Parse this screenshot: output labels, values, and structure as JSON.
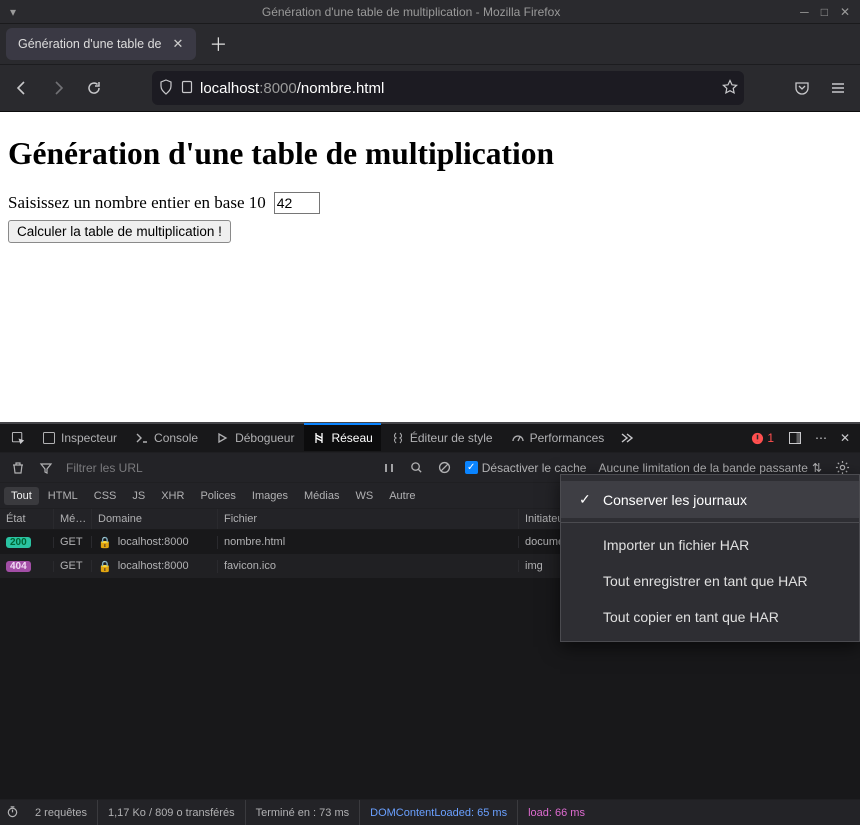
{
  "window": {
    "title": "Génération d'une table de multiplication - Mozilla Firefox"
  },
  "tab": {
    "title": "Génération d'une table de"
  },
  "url": {
    "host": "localhost",
    "port": ":8000",
    "path": "/nombre.html"
  },
  "page": {
    "heading": "Génération d'une table de multiplication",
    "label": "Saisissez un nombre entier en base 10",
    "input_value": "42",
    "button": "Calculer la table de multiplication !"
  },
  "devtools_tabs": {
    "inspector": "Inspecteur",
    "console": "Console",
    "debugger": "Débogueur",
    "network": "Réseau",
    "style": "Éditeur de style",
    "perf": "Performances",
    "error_count": "1"
  },
  "subbar": {
    "filter_placeholder": "Filtrer les URL",
    "disable_cache": "Désactiver le cache",
    "throttle": "Aucune limitation de la bande passante"
  },
  "filters": {
    "all": "Tout",
    "html": "HTML",
    "css": "CSS",
    "js": "JS",
    "xhr": "XHR",
    "fonts": "Polices",
    "images": "Images",
    "media": "Médias",
    "ws": "WS",
    "other": "Autre"
  },
  "net_headers": {
    "status": "État",
    "method": "Mé…",
    "domain": "Domaine",
    "file": "Fichier",
    "initiator": "Initiateur"
  },
  "net_rows": [
    {
      "status": "200",
      "method": "GET",
      "domain": "localhost:8000",
      "file": "nombre.html",
      "initiator": "document"
    },
    {
      "status": "404",
      "method": "GET",
      "domain": "localhost:8000",
      "file": "favicon.ico",
      "initiator": "img"
    }
  ],
  "popup": {
    "persist": "Conserver les journaux",
    "import": "Importer un fichier HAR",
    "saveall": "Tout enregistrer en tant que HAR",
    "copyall": "Tout copier en tant que HAR"
  },
  "status": {
    "requests": "2 requêtes",
    "transfer": "1,17 Ko / 809 o transférés",
    "finish": "Terminé en : 73 ms",
    "dcl": "DOMContentLoaded: 65 ms",
    "load": "load: 66 ms"
  }
}
